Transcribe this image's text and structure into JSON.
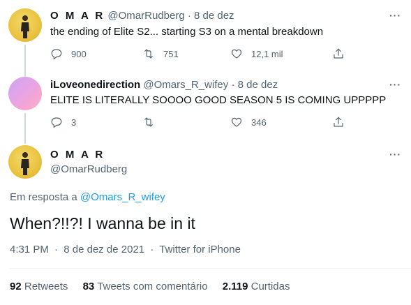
{
  "tweets": [
    {
      "display_name": "O M A R",
      "handle": "@OmarRudberg",
      "dot": "·",
      "date": "8 de dez",
      "text": "the ending of Elite S2... starting S3 on a mental breakdown",
      "reply_count": "900",
      "retweet_count": "751",
      "like_count": "12,1 mil"
    },
    {
      "display_name": "iLoveonedirection",
      "handle": "@Omars_R_wifey",
      "dot": "·",
      "date": "8 de dez",
      "text": "ELITE IS LITERALLY SOOOO GOOD SEASON 5 IS COMING UPPPPP",
      "reply_count": "3",
      "retweet_count": "",
      "like_count": "346"
    }
  ],
  "main_tweet": {
    "display_name": "O M A R",
    "handle": "@OmarRudberg",
    "replying_prefix": "Em resposta a",
    "replying_to": "@Omars_R_wifey",
    "text": "When?!!?! I wanna be in it",
    "time": "4:31 PM",
    "dot": "·",
    "date": "8 de dez de 2021",
    "source": "Twitter for iPhone"
  },
  "stats": {
    "retweets_value": "92",
    "retweets_label": "Retweets",
    "quotes_value": "83",
    "quotes_label": "Tweets com comentário",
    "likes_value": "2.119",
    "likes_label": "Curtidas"
  },
  "more_icon": "···",
  "colors": {
    "accent": "#1d9bf0",
    "muted": "#536471",
    "text": "#0f1419",
    "divider": "#eff3f4"
  },
  "icons": [
    "reply-icon",
    "retweet-icon",
    "like-icon",
    "share-icon",
    "more-icon"
  ]
}
